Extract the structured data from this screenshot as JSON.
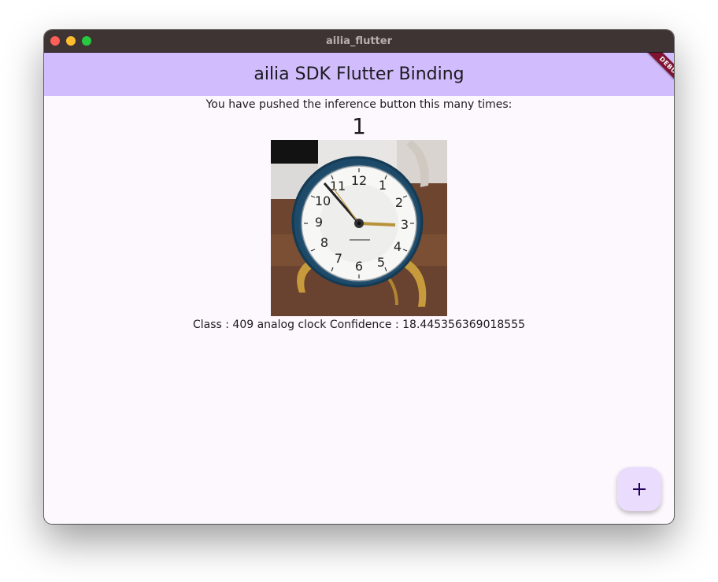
{
  "window": {
    "title": "ailia_flutter"
  },
  "appbar": {
    "title": "ailia SDK Flutter Binding",
    "color": "#d1bcfd"
  },
  "debug_banner": {
    "label": "DEBUG"
  },
  "main": {
    "pushed_text": "You have pushed the inference button this many times:",
    "counter": "1",
    "image": {
      "icon": "analog-clock-photo"
    },
    "result": "Class : 409 analog clock Confidence : 18.445356369018555"
  },
  "fab": {
    "icon": "plus-icon",
    "color": "#eadcfd"
  }
}
